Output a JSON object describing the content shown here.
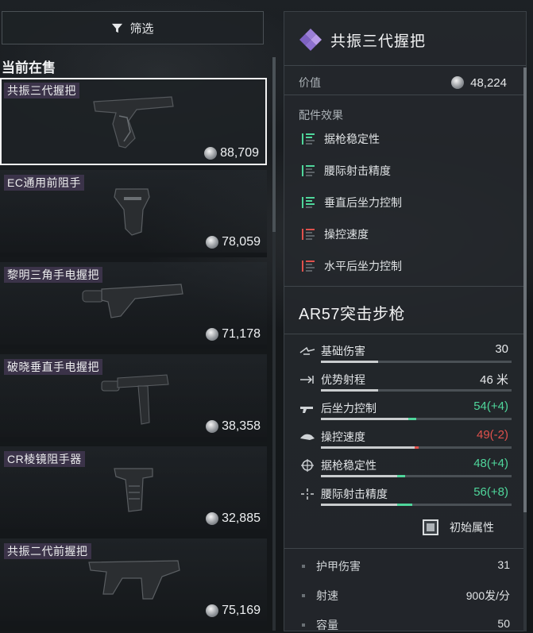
{
  "filter": {
    "label": "筛选",
    "icon": "filter-icon"
  },
  "section_title": "当前在售",
  "items": [
    {
      "name": "共振三代握把",
      "price": "88,709",
      "selected": true
    },
    {
      "name": "EC通用前阻手",
      "price": "78,059",
      "selected": false
    },
    {
      "name": "黎明三角手电握把",
      "price": "71,178",
      "selected": false
    },
    {
      "name": "破晓垂直手电握把",
      "price": "38,358",
      "selected": false
    },
    {
      "name": "CR棱镜阻手器",
      "price": "32,885",
      "selected": false
    },
    {
      "name": "共振二代前握把",
      "price": "75,169",
      "selected": false
    }
  ],
  "detail": {
    "title": "共振三代握把",
    "title_icon": "diamond-cluster-icon",
    "value_label": "价值",
    "value": "48,224",
    "effects_label": "配件效果",
    "effects": [
      {
        "label": "据枪稳定性",
        "tone": "positive",
        "level": 2
      },
      {
        "label": "腰际射击精度",
        "tone": "positive",
        "level": 1
      },
      {
        "label": "垂直后坐力控制",
        "tone": "positive",
        "level": 3
      },
      {
        "label": "操控速度",
        "tone": "negative",
        "level": 1
      },
      {
        "label": "水平后坐力控制",
        "tone": "negative",
        "level": 1
      }
    ],
    "weapon_name": "AR57突击步枪",
    "stats": [
      {
        "label": "基础伤害",
        "value": "30",
        "tone": "neutral",
        "fill": 0.3,
        "delta": 0
      },
      {
        "label": "优势射程",
        "value": "46 米",
        "tone": "neutral",
        "fill": 0.3,
        "delta": 0
      },
      {
        "label": "后坐力控制",
        "value": "54(+4)",
        "tone": "up",
        "fill": 0.5,
        "delta": 0.04
      },
      {
        "label": "操控速度",
        "value": "49(-2)",
        "tone": "down",
        "fill": 0.49,
        "delta": -0.02
      },
      {
        "label": "据枪稳定性",
        "value": "48(+4)",
        "tone": "up",
        "fill": 0.44,
        "delta": 0.04
      },
      {
        "label": "腰际射击精度",
        "value": "56(+8)",
        "tone": "up",
        "fill": 0.48,
        "delta": 0.08
      }
    ],
    "toggle_label": "初始属性",
    "attributes": [
      {
        "label": "护甲伤害",
        "value": "31"
      },
      {
        "label": "射速",
        "value": "900发/分"
      },
      {
        "label": "容量",
        "value": "50"
      }
    ],
    "colors": {
      "positive": "#4fd69b",
      "negative": "#e0514c"
    }
  }
}
